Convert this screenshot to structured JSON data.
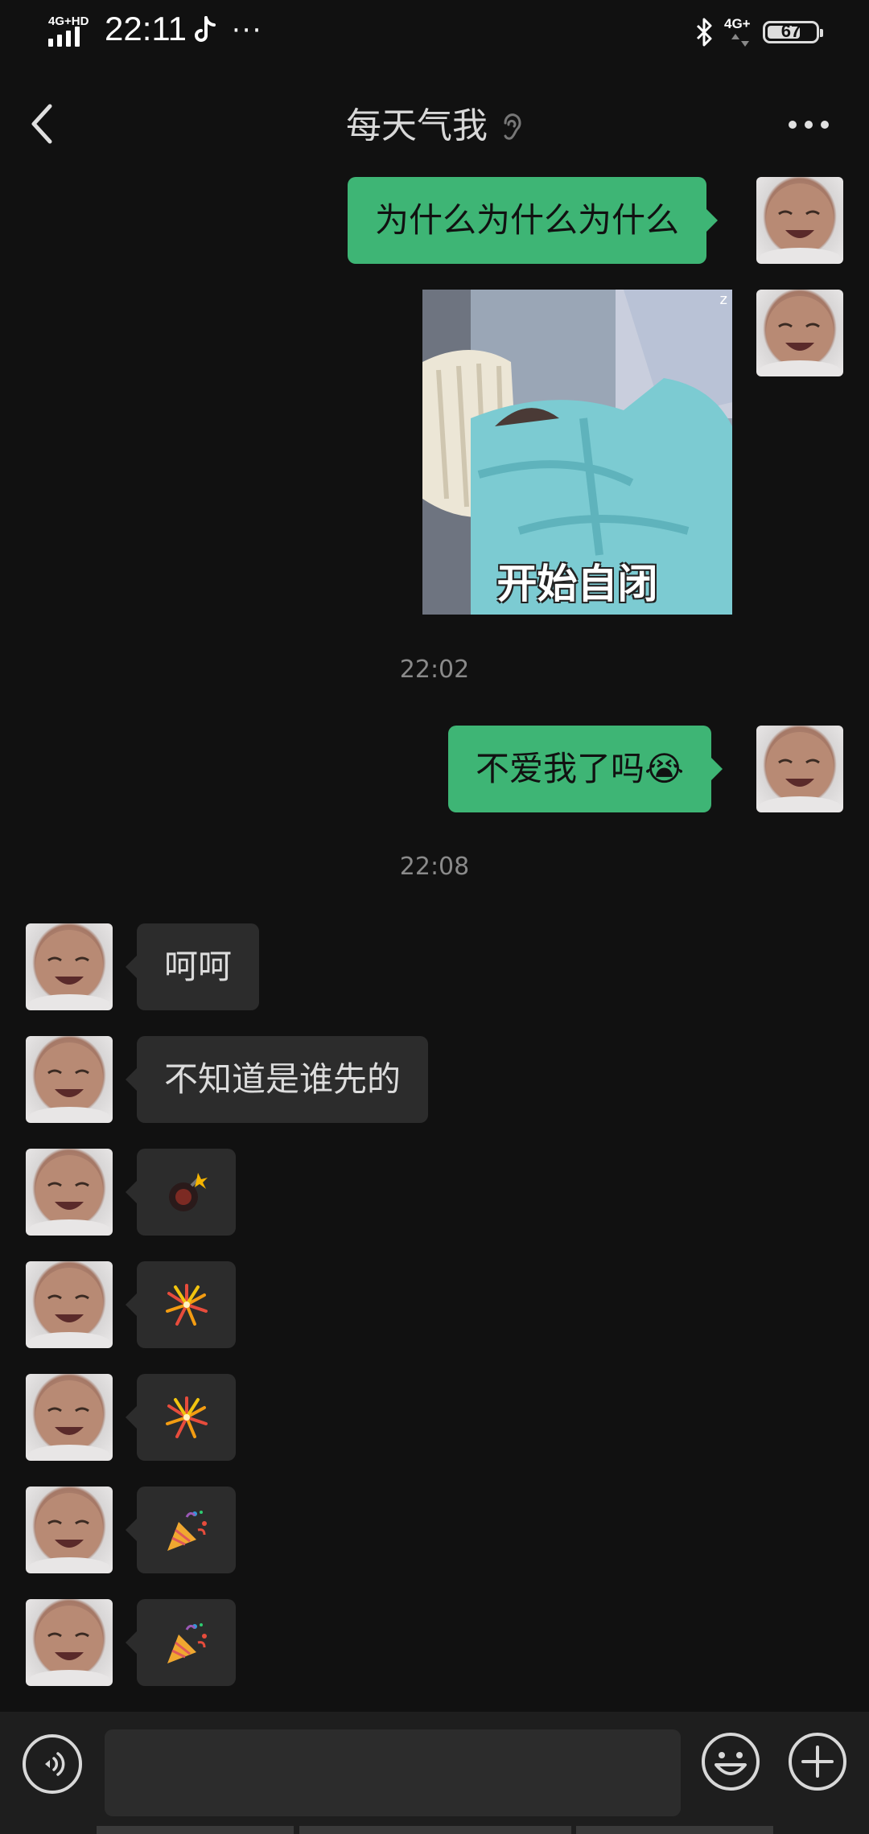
{
  "status_bar": {
    "network_left": "4G+HD",
    "time": "22:11",
    "more": "···",
    "network_right": "4G+",
    "battery": "67"
  },
  "header": {
    "title": "每天气我",
    "back_icon": "chevron-left-icon",
    "ear_icon": "ear-icon",
    "more_icon": "more-dots-icon"
  },
  "messages": [
    {
      "side": "me",
      "type": "text",
      "text": "为什么为什么为什么"
    },
    {
      "side": "me",
      "type": "sticker",
      "caption": "开始自闭",
      "mark": "z"
    },
    {
      "side": "system",
      "type": "time",
      "text": "22:02"
    },
    {
      "side": "me",
      "type": "text",
      "text": "不爱我了吗😭"
    },
    {
      "side": "system",
      "type": "time",
      "text": "22:08"
    },
    {
      "side": "them",
      "type": "text",
      "text": "呵呵"
    },
    {
      "side": "them",
      "type": "text",
      "text": "不知道是谁先的"
    },
    {
      "side": "them",
      "type": "emoji",
      "emoji": "bomb-icon"
    },
    {
      "side": "them",
      "type": "emoji",
      "emoji": "firework-icon"
    },
    {
      "side": "them",
      "type": "emoji",
      "emoji": "firework-icon"
    },
    {
      "side": "them",
      "type": "emoji",
      "emoji": "party-popper-icon"
    },
    {
      "side": "them",
      "type": "emoji",
      "emoji": "party-popper-icon"
    }
  ],
  "input_bar": {
    "voice_icon": "voice-icon",
    "text_value": "",
    "emoji_icon": "smiley-icon",
    "plus_icon": "plus-icon"
  },
  "colors": {
    "background": "#111111",
    "my_bubble": "#3eb575",
    "their_bubble": "#2c2c2c"
  }
}
